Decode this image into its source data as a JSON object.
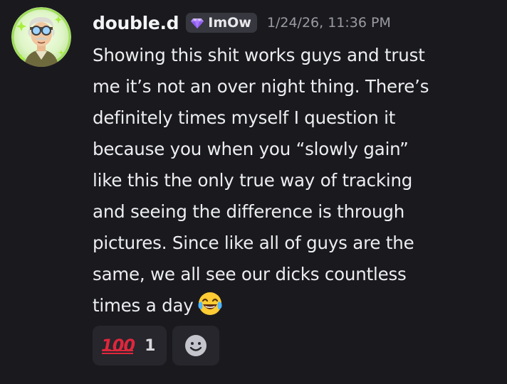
{
  "message": {
    "author": {
      "username": "double.d",
      "avatar_icon": "avatar-character-icon",
      "tag": {
        "icon": "gem-icon",
        "label": "ImOw",
        "color": "#a78bfa"
      }
    },
    "timestamp": "1/24/26, 11:36 PM",
    "text": "Showing this shit works guys and trust\nme it’s not an over night thing. There’s\ndefinitely times myself I question it\nbecause you when you “slowly gain”\nlike this the only true way of tracking\nand seeing the difference is through\npictures. Since like all of guys are the\nsame, we all see our dicks countless\ntimes a day",
    "trailing_emoji": "laughing-tears-emoji",
    "reactions": [
      {
        "emoji": "hundred-points-icon",
        "glyph": "100",
        "count": "1"
      }
    ],
    "add_reaction_icon": "smiley-icon"
  },
  "colors": {
    "background": "#1a1a1e",
    "text": "#eceef0",
    "timestamp": "#9a9aa3",
    "reaction_bg": "#26262c",
    "tag_bg": "#37373f",
    "hundred": "#e0263c"
  }
}
